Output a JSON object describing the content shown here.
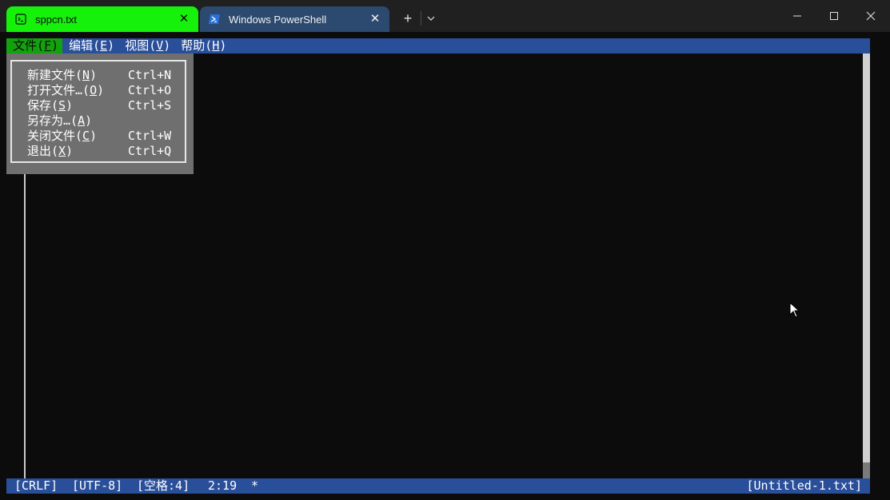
{
  "tabs": [
    {
      "title": "sppcn.txt",
      "icon": "terminal-icon",
      "active": true
    },
    {
      "title": "Windows PowerShell",
      "icon": "powershell-icon",
      "active": false
    }
  ],
  "tab_close_glyph": "✕",
  "new_tab_glyph": "+",
  "menubar": {
    "items": [
      {
        "text": "文件(",
        "key": "F",
        "after": ")"
      },
      {
        "text": "编辑(",
        "key": "E",
        "after": ")"
      },
      {
        "text": "视图(",
        "key": "V",
        "after": ")"
      },
      {
        "text": "帮助(",
        "key": "H",
        "after": ")"
      }
    ]
  },
  "file_menu": {
    "items": [
      {
        "pre": "新建文件(",
        "key": "N",
        "post": ")",
        "shortcut": "Ctrl+N"
      },
      {
        "pre": "打开文件…(",
        "key": "O",
        "post": ")",
        "shortcut": "Ctrl+O"
      },
      {
        "pre": "保存(",
        "key": "S",
        "post": ")",
        "shortcut": "Ctrl+S"
      },
      {
        "pre": "另存为…(",
        "key": "A",
        "post": ")",
        "shortcut": ""
      },
      {
        "pre": "关闭文件(",
        "key": "C",
        "post": ")",
        "shortcut": "Ctrl+W"
      },
      {
        "pre": "退出(",
        "key": "X",
        "post": ")",
        "shortcut": "Ctrl+Q"
      }
    ]
  },
  "statusbar": {
    "line_ending": "[CRLF]",
    "encoding": "[UTF-8]",
    "indent": "[空格:4]",
    "position": "2:19",
    "modified": "*",
    "filename": "[Untitled-1.txt]"
  },
  "colors": {
    "tab_active": "#16f10c",
    "tab_inactive": "#2c4a70",
    "menubar": "#2a4f9a",
    "menu_active": "#13a10e",
    "dropdown": "#6f6f6f",
    "editor_bg": "#0c0c0c"
  }
}
